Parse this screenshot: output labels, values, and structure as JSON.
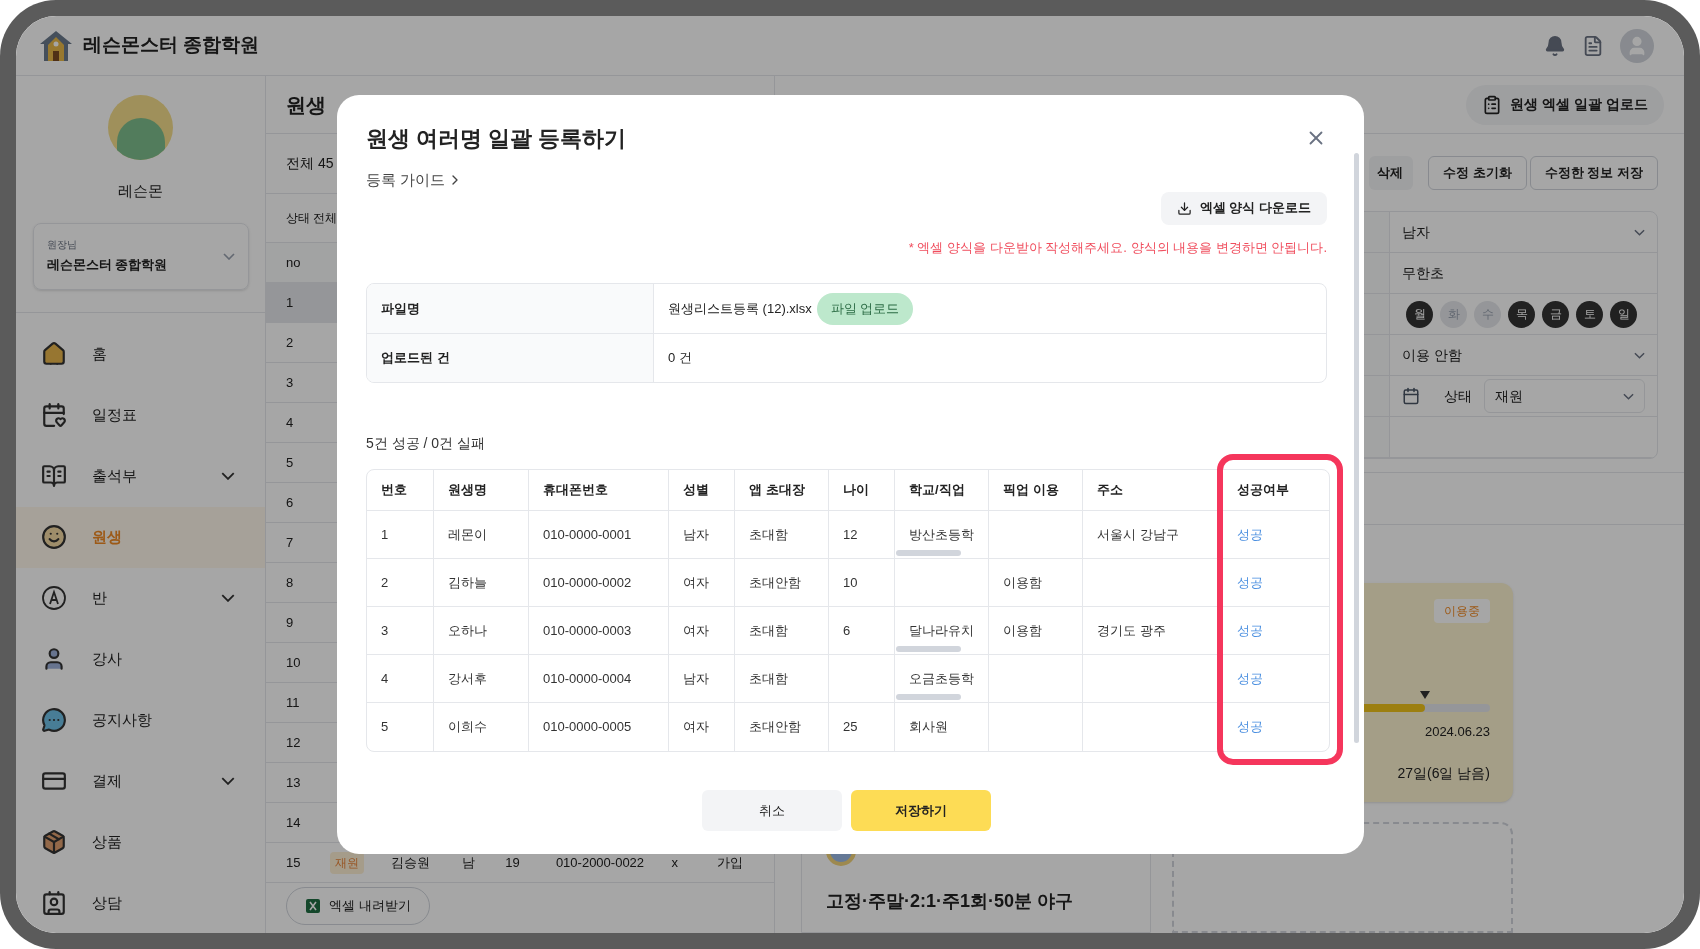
{
  "header": {
    "title": "레슨몬스터 종합학원"
  },
  "sidebar": {
    "profile_name": "레슨몬",
    "academy": {
      "role": "원장님",
      "name": "레슨몬스터 종합학원"
    },
    "items": [
      {
        "label": "홈",
        "selected": false,
        "has_submenu": false
      },
      {
        "label": "일정표",
        "selected": false,
        "has_submenu": false
      },
      {
        "label": "출석부",
        "selected": false,
        "has_submenu": true
      },
      {
        "label": "원생",
        "selected": true,
        "has_submenu": false
      },
      {
        "label": "반",
        "selected": false,
        "has_submenu": true
      },
      {
        "label": "강사",
        "selected": false,
        "has_submenu": false
      },
      {
        "label": "공지사항",
        "selected": false,
        "has_submenu": false
      },
      {
        "label": "결제",
        "selected": false,
        "has_submenu": true
      },
      {
        "label": "상품",
        "selected": false,
        "has_submenu": false
      },
      {
        "label": "상담",
        "selected": false,
        "has_submenu": false
      }
    ]
  },
  "student_list": {
    "title": "원생",
    "total": "전체 45",
    "filter": "상태 전체",
    "no_header": "no",
    "rows": [
      {
        "no": "1",
        "selected": true
      },
      {
        "no": "2",
        "selected": false
      },
      {
        "no": "3",
        "selected": false
      },
      {
        "no": "4",
        "selected": false
      },
      {
        "no": "5",
        "selected": false
      },
      {
        "no": "6",
        "selected": false
      },
      {
        "no": "7",
        "selected": false
      },
      {
        "no": "8",
        "selected": false
      },
      {
        "no": "9",
        "selected": false
      },
      {
        "no": "10",
        "selected": false
      },
      {
        "no": "11",
        "selected": false
      },
      {
        "no": "12",
        "selected": false
      },
      {
        "no": "13",
        "selected": false
      },
      {
        "no": "14",
        "selected": false
      },
      {
        "no": "15",
        "selected": false,
        "status": "재원",
        "cells": [
          "김승원",
          "남",
          "19",
          "010-2000-0022",
          "x",
          "가입"
        ]
      }
    ],
    "export_button": "엑셀 내려받기"
  },
  "detail_panel": {
    "upload_button": "원생 엑셀 일괄 업로드",
    "actions": [
      "삭제",
      "수정 초기화",
      "수정한 정보 저장"
    ],
    "fields": [
      {
        "kind": "select",
        "value": "남자"
      },
      {
        "kind": "text",
        "value": "무한초"
      },
      {
        "kind": "days",
        "days": [
          {
            "label": "월",
            "selected": true
          },
          {
            "label": "화",
            "selected": false
          },
          {
            "label": "수",
            "selected": false
          },
          {
            "label": "목",
            "selected": true
          },
          {
            "label": "금",
            "selected": true
          },
          {
            "label": "토",
            "selected": true
          },
          {
            "label": "일",
            "selected": true
          }
        ]
      },
      {
        "kind": "select",
        "value": "이용 안함"
      },
      {
        "kind": "date_status",
        "status_label": "상태",
        "status_value": "재원"
      },
      {
        "kind": "blank"
      }
    ],
    "pass_card": {
      "badge": "이용중",
      "level": 0.78,
      "end_date": "2024.06.23",
      "remaining": "27일(6일 남음)"
    },
    "class_card": {
      "title": "고정·주말·2:1·주1회·50분 야구"
    }
  },
  "modal": {
    "title": "원생 여러명 일괄 등록하기",
    "guide_link": "등록 가이드",
    "download_button": "엑셀 양식 다운로드",
    "notice": "* 엑셀 양식을 다운받아 작성해주세요. 양식의 내용을 변경하면 안됩니다.",
    "file_info": [
      {
        "label": "파일명",
        "value": "원생리스트등록 (12).xlsx",
        "upload_button": "파일 업로드"
      },
      {
        "label": "업로드된 건",
        "value": "0 건"
      }
    ],
    "summary": "5건 성공 / 0건 실패",
    "table": {
      "highlight_last_column": true,
      "columns": [
        "번호",
        "원생명",
        "휴대폰번호",
        "성별",
        "앱 초대장",
        "나이",
        "학교/직업",
        "픽업 이용",
        "주소",
        "성공여부"
      ],
      "rows": [
        {
          "no": "1",
          "name": "레몬이",
          "phone": "010-0000-0001",
          "gender": "남자",
          "invite": "초대함",
          "age": "12",
          "school": "방산초등학",
          "school_clipped": true,
          "address": "서울시 강남구",
          "result": "성공"
        },
        {
          "no": "2",
          "name": "김하늘",
          "phone": "010-0000-0002",
          "gender": "여자",
          "invite": "초대안함",
          "age": "10",
          "school_clipped": false,
          "pickup": "이용함",
          "result": "성공"
        },
        {
          "no": "3",
          "name": "오하나",
          "phone": "010-0000-0003",
          "gender": "여자",
          "invite": "초대함",
          "age": "6",
          "school": "달나라유치",
          "school_clipped": true,
          "pickup": "이용함",
          "address": "경기도 광주",
          "result": "성공"
        },
        {
          "no": "4",
          "name": "강서후",
          "phone": "010-0000-0004",
          "gender": "남자",
          "invite": "초대함",
          "school": "오금초등학",
          "school_clipped": true,
          "result": "성공"
        },
        {
          "no": "5",
          "name": "이희수",
          "phone": "010-0000-0005",
          "gender": "여자",
          "invite": "초대안함",
          "age": "25",
          "school": "회사원",
          "school_clipped": false,
          "result": "성공"
        }
      ]
    },
    "buttons": [
      {
        "kind": "secondary",
        "label": "취소"
      },
      {
        "kind": "primary",
        "label": "저장하기"
      }
    ]
  }
}
